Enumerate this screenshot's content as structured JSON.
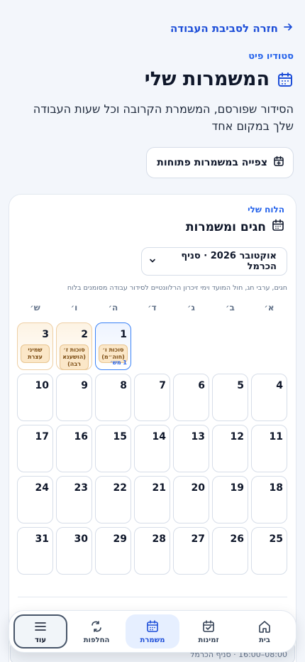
{
  "back": {
    "label": "חזרה לסביבת העבודה",
    "icon": "arrow-right-icon"
  },
  "studio": "סטודיו פיט",
  "page": {
    "title": "המשמרות שלי",
    "subtitle": "הסידור שפורסם, המשמרת הקרובה וכל שעות העבודה שלך במקום אחד"
  },
  "open_shifts_button": "צפייה במשמרות פתוחות",
  "calendar": {
    "kicker": "הלוח שלי",
    "title": "חגים ומשמרות",
    "selector_value": "אוקטובר 2026 · סניף הכרמל",
    "legend_note": "חגים, ערבי חג, חול המועד וימי זיכרון הרלוונטיים לסידור עבודה מסומנים בלוח",
    "weekdays": [
      "א׳",
      "ב׳",
      "ג׳",
      "ד׳",
      "ה׳",
      "ו׳",
      "ש׳"
    ],
    "weeks": [
      [
        {
          "num": ""
        },
        {
          "num": ""
        },
        {
          "num": ""
        },
        {
          "num": ""
        },
        {
          "num": "1",
          "today": true,
          "tag": "סוכות ו׳ (חוה״מ)",
          "shifts": "1 מש׳"
        },
        {
          "num": "2",
          "holiday": true,
          "tag": "סוכות ז׳ (הושענא רבה)"
        },
        {
          "num": "3",
          "holiday": true,
          "tag": "שמיני עצרת"
        }
      ],
      [
        {
          "num": "4"
        },
        {
          "num": "5"
        },
        {
          "num": "6"
        },
        {
          "num": "7"
        },
        {
          "num": "8"
        },
        {
          "num": "9"
        },
        {
          "num": "10"
        }
      ],
      [
        {
          "num": "11"
        },
        {
          "num": "12"
        },
        {
          "num": "13"
        },
        {
          "num": "14"
        },
        {
          "num": "15"
        },
        {
          "num": "16"
        },
        {
          "num": "17"
        }
      ],
      [
        {
          "num": "18"
        },
        {
          "num": "19"
        },
        {
          "num": "20"
        },
        {
          "num": "21"
        },
        {
          "num": "22"
        },
        {
          "num": "23"
        },
        {
          "num": "24"
        }
      ],
      [
        {
          "num": "25"
        },
        {
          "num": "26"
        },
        {
          "num": "27"
        },
        {
          "num": "28"
        },
        {
          "num": "29"
        },
        {
          "num": "30"
        },
        {
          "num": "31"
        }
      ]
    ]
  },
  "peek_row": "08:00–16:00 · סניף הכרמל",
  "nav": [
    {
      "label": "בית",
      "icon": "home-icon",
      "active": false
    },
    {
      "label": "זמינות",
      "icon": "calendar-check-icon",
      "active": false
    },
    {
      "label": "משמרת",
      "icon": "calendar-icon",
      "active": true
    },
    {
      "label": "החלפות",
      "icon": "swap-icon",
      "active": false
    },
    {
      "label": "עוד",
      "icon": "menu-icon",
      "active": false,
      "more": true
    }
  ],
  "colors": {
    "accent": "#2563eb",
    "holiday": "#fbe7c8",
    "today_border": "#3b82f6"
  }
}
